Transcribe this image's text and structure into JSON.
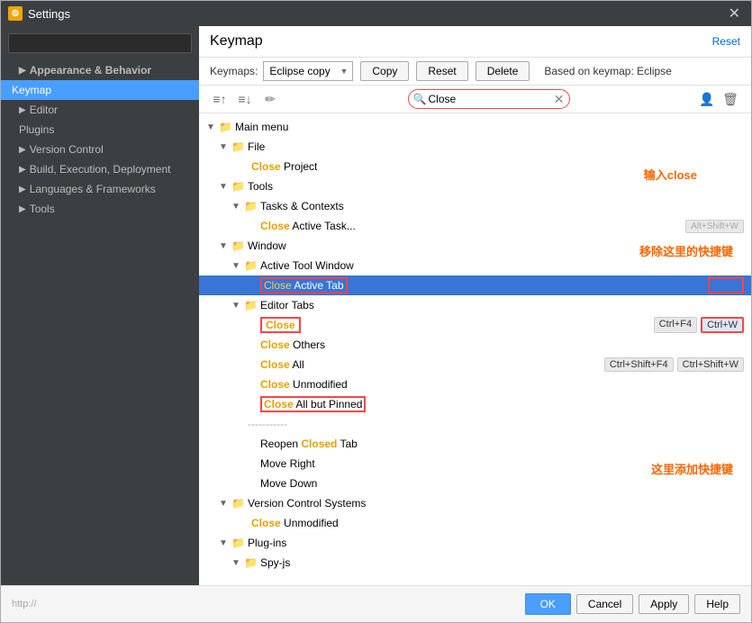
{
  "window": {
    "title": "Settings",
    "icon": "⚙",
    "close_label": "✕"
  },
  "left_panel": {
    "search_placeholder": "",
    "nav_items": [
      {
        "label": "Appearance & Behavior",
        "level": 0,
        "bold": true,
        "arrow": "▶"
      },
      {
        "label": "Keymap",
        "level": 0,
        "selected": true
      },
      {
        "label": "Editor",
        "level": 0,
        "arrow": "▶"
      },
      {
        "label": "Plugins",
        "level": 0
      },
      {
        "label": "Version Control",
        "level": 0,
        "arrow": "▶"
      },
      {
        "label": "Build, Execution, Deployment",
        "level": 0,
        "arrow": "▶"
      },
      {
        "label": "Languages & Frameworks",
        "level": 0,
        "arrow": "▶"
      },
      {
        "label": "Tools",
        "level": 0,
        "arrow": "▶"
      }
    ]
  },
  "right_panel": {
    "title": "Keymap",
    "reset_label": "Reset",
    "keymaps_label": "Keymaps:",
    "keymap_value": "Eclipse copy",
    "copy_btn": "Copy",
    "reset_btn": "Reset",
    "delete_btn": "Delete",
    "based_on": "Based on keymap: Eclipse",
    "search_value": "Close",
    "search_placeholder": "Close"
  },
  "tree": {
    "items": [
      {
        "label": "Main menu",
        "level": 0,
        "type": "folder",
        "arrow": "▼"
      },
      {
        "label": "File",
        "level": 1,
        "type": "folder",
        "arrow": "▼"
      },
      {
        "label": "Close Project",
        "level": 2,
        "type": "action",
        "close_part": "Close"
      },
      {
        "label": "Tools",
        "level": 1,
        "type": "folder",
        "arrow": "▼"
      },
      {
        "label": "Tasks & Contexts",
        "level": 2,
        "type": "folder",
        "arrow": "▼"
      },
      {
        "label": "Close Active Task...",
        "level": 3,
        "type": "action",
        "close_part": "Close"
      },
      {
        "label": "Window",
        "level": 1,
        "type": "folder",
        "arrow": "▼"
      },
      {
        "label": "Active Tool Window",
        "level": 2,
        "type": "folder",
        "arrow": "▼"
      },
      {
        "label": "Close Active Tab",
        "level": 3,
        "type": "action",
        "close_part": "Close",
        "selected": true,
        "shortcuts": []
      },
      {
        "label": "Editor Tabs",
        "level": 2,
        "type": "folder",
        "arrow": "▼"
      },
      {
        "label": "Close",
        "level": 3,
        "type": "action",
        "close_part": "Close",
        "shortcuts": [
          "Ctrl+F4",
          "Ctrl+W"
        ]
      },
      {
        "label": "Close Others",
        "level": 3,
        "type": "action",
        "close_part": "Close"
      },
      {
        "label": "Close All",
        "level": 3,
        "type": "action",
        "close_part": "Close",
        "shortcuts": [
          "Ctrl+Shift+F4",
          "Ctrl+Shift+W"
        ]
      },
      {
        "label": "Close Unmodified",
        "level": 3,
        "type": "action",
        "close_part": "Close"
      },
      {
        "label": "Close All but Pinned",
        "level": 3,
        "type": "action",
        "close_part": "Close"
      },
      {
        "label": "---separator---",
        "level": 3,
        "type": "separator"
      },
      {
        "label": "Reopen Closed Tab",
        "level": 3,
        "type": "action",
        "closed_part": "Closed"
      },
      {
        "label": "Move Right",
        "level": 3,
        "type": "action"
      },
      {
        "label": "Move Down",
        "level": 3,
        "type": "action"
      },
      {
        "label": "Version Control Systems",
        "level": 1,
        "type": "folder",
        "arrow": "▼"
      },
      {
        "label": "Close Unmodified",
        "level": 2,
        "type": "action",
        "close_part": "Close"
      },
      {
        "label": "Plug-ins",
        "level": 1,
        "type": "folder",
        "arrow": "▼"
      },
      {
        "label": "Spy-js",
        "level": 2,
        "type": "folder",
        "arrow": "▼"
      }
    ]
  },
  "bottom_bar": {
    "ok_label": "OK",
    "cancel_label": "Cancel",
    "apply_label": "Apply",
    "help_label": "Help"
  },
  "annotations": {
    "input_close": "输入close",
    "remove_shortcut": "移除这里的快捷键",
    "add_shortcut": "这里添加快捷键"
  },
  "icons": {
    "search": "🔍",
    "clear": "✕",
    "user": "👤",
    "trash": "🗑",
    "folder": "📁",
    "expand": "▶",
    "collapse": "▼",
    "sort_asc": "↑≡",
    "sort_desc": "↓≡",
    "edit": "✏"
  }
}
